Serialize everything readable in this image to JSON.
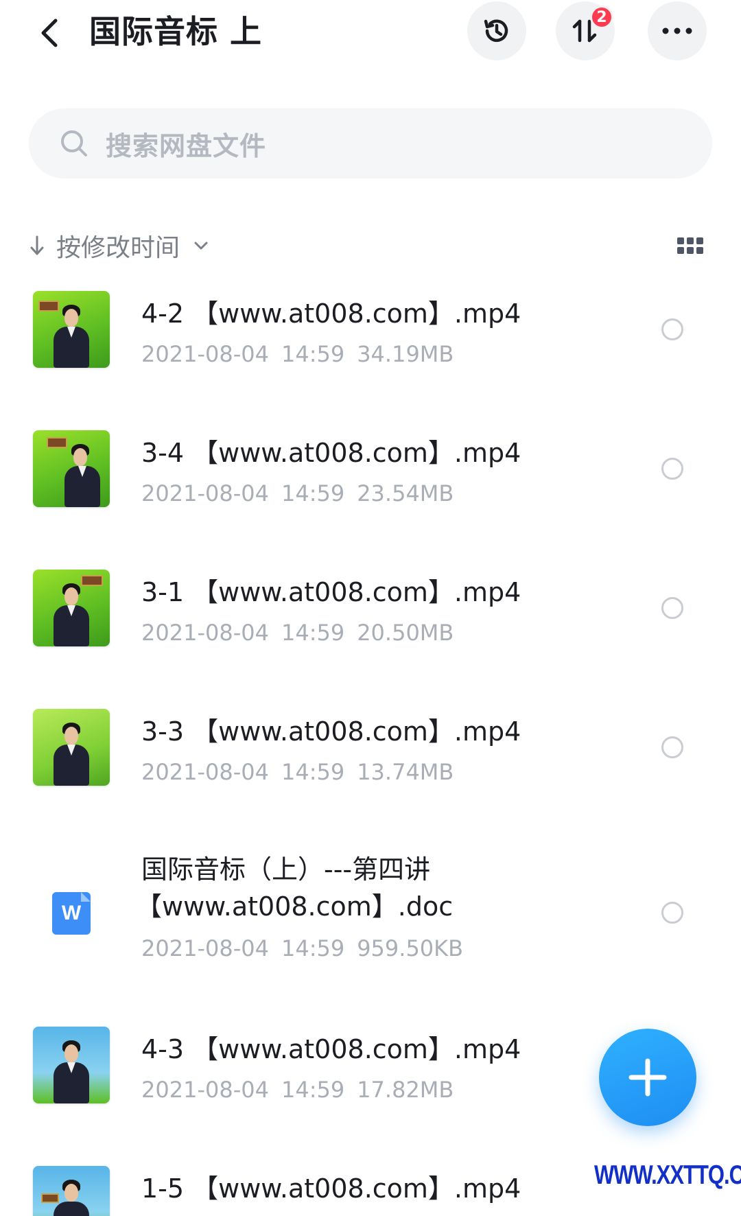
{
  "header": {
    "title": "国际音标 上",
    "back_icon": "chevron-left-icon",
    "history_icon": "history-icon",
    "transfer_icon": "transfer-icon",
    "transfer_badge": "2",
    "more_icon": "more-dots-icon"
  },
  "search": {
    "placeholder": "搜索网盘文件",
    "icon": "search-icon"
  },
  "sort": {
    "label": "按修改时间",
    "arrow_icon": "arrow-down-icon",
    "chevron_icon": "chevron-down-icon",
    "view_icon": "grid-view-icon"
  },
  "files": [
    {
      "name": "4-2 【www.at008.com】.mp4",
      "date": "2021-08-04",
      "time": "14:59",
      "size": "34.19MB",
      "type": "video"
    },
    {
      "name": "3-4 【www.at008.com】.mp4",
      "date": "2021-08-04",
      "time": "14:59",
      "size": "23.54MB",
      "type": "video"
    },
    {
      "name": "3-1 【www.at008.com】.mp4",
      "date": "2021-08-04",
      "time": "14:59",
      "size": "20.50MB",
      "type": "video"
    },
    {
      "name": "3-3 【www.at008.com】.mp4",
      "date": "2021-08-04",
      "time": "14:59",
      "size": "13.74MB",
      "type": "video"
    },
    {
      "name_line1": "国际音标（上）---第四讲",
      "name_line2": "【www.at008.com】.doc",
      "date": "2021-08-04",
      "time": "14:59",
      "size": "959.50KB",
      "type": "doc",
      "doc_letter": "W"
    },
    {
      "name": "4-3 【www.at008.com】.mp4",
      "date": "2021-08-04",
      "time": "14:59",
      "size": "17.82MB",
      "type": "video"
    },
    {
      "name": "1-5 【www.at008.com】.mp4",
      "type": "video"
    }
  ],
  "fab": {
    "icon": "plus-icon"
  },
  "watermark": "WWW.XXTTQ.COM",
  "colors": {
    "accent": "#1e8df2",
    "badge": "#ff3b4f",
    "doc_blue": "#3d8ef7",
    "meta_gray": "#a9adb5"
  }
}
